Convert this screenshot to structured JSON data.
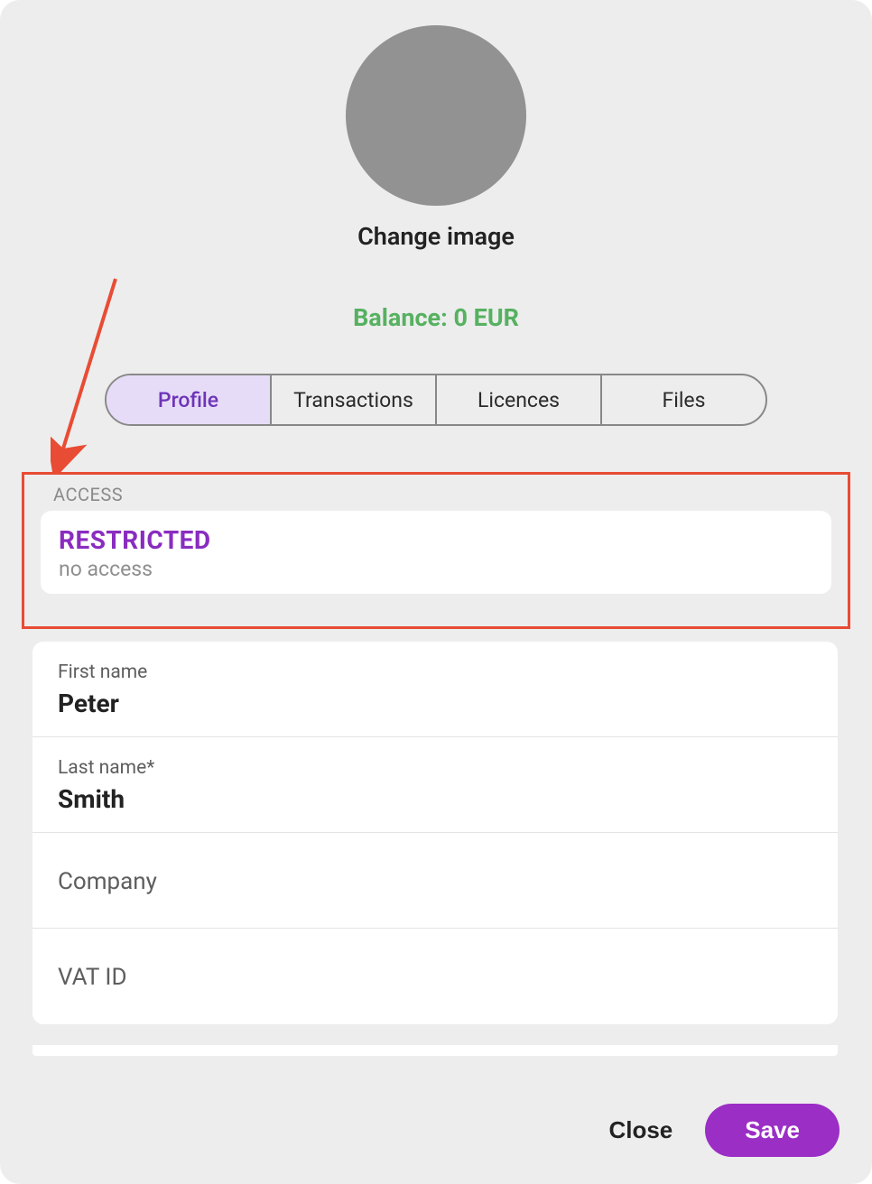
{
  "header": {
    "change_image_label": "Change image",
    "balance_text": "Balance: 0 EUR"
  },
  "tabs": [
    {
      "label": "Profile",
      "active": true
    },
    {
      "label": "Transactions",
      "active": false
    },
    {
      "label": "Licences",
      "active": false
    },
    {
      "label": "Files",
      "active": false
    }
  ],
  "access": {
    "section_label": "ACCESS",
    "status": "RESTRICTED",
    "subtitle": "no access"
  },
  "fields": {
    "first_name": {
      "label": "First name",
      "value": "Peter"
    },
    "last_name": {
      "label": "Last name*",
      "value": "Smith"
    },
    "company": {
      "label": "Company",
      "value": ""
    },
    "vat_id": {
      "label": "VAT ID",
      "value": ""
    }
  },
  "footer": {
    "close_label": "Close",
    "save_label": "Save"
  },
  "colors": {
    "accent_purple": "#9b2ec5",
    "highlight_red": "#e84c34",
    "balance_green": "#56b160"
  }
}
